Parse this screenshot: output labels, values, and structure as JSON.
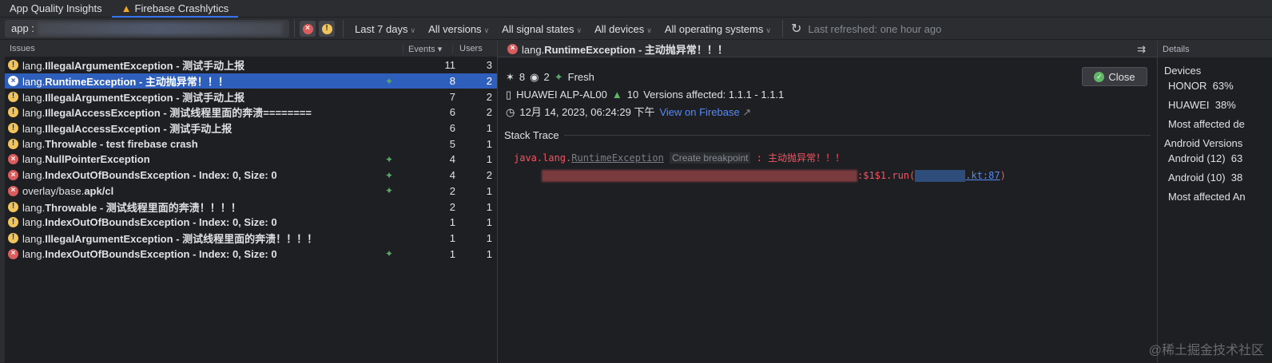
{
  "tabs": [
    {
      "label": "App Quality Insights"
    },
    {
      "label": "Firebase Crashlytics",
      "icon": "firebase-flame-icon"
    }
  ],
  "toolbar": {
    "app_prefix": "app :",
    "filters": [
      "Last 7 days",
      "All versions",
      "All signal states",
      "All devices",
      "All operating systems"
    ],
    "last_refreshed": "Last refreshed: one hour ago"
  },
  "issues": {
    "headers": {
      "issues": "Issues",
      "events": "Events",
      "users": "Users"
    },
    "rows": [
      {
        "type": "warn",
        "pre": "lang.",
        "name": "IllegalArgumentException",
        "msg": " - 测试手动上报",
        "fresh": false,
        "events": "11",
        "users": "3"
      },
      {
        "type": "error",
        "pre": "lang.",
        "name": "RuntimeException",
        "msg": " - 主动抛异常！！！",
        "fresh": true,
        "events": "8",
        "users": "2",
        "selected": true
      },
      {
        "type": "warn",
        "pre": "lang.",
        "name": "IllegalArgumentException",
        "msg": " - 测试手动上报",
        "fresh": false,
        "events": "7",
        "users": "2"
      },
      {
        "type": "warn",
        "pre": "lang.",
        "name": "IllegalAccessException",
        "msg": " - 测试线程里面的奔溃========",
        "fresh": false,
        "events": "6",
        "users": "2"
      },
      {
        "type": "warn",
        "pre": "lang.",
        "name": "IllegalAccessException",
        "msg": " - 测试手动上报",
        "fresh": false,
        "events": "6",
        "users": "1"
      },
      {
        "type": "warn",
        "pre": "lang.",
        "name": "Throwable",
        "msg": " - test firebase crash",
        "fresh": false,
        "events": "5",
        "users": "1"
      },
      {
        "type": "error",
        "pre": "lang.",
        "name": "NullPointerException",
        "msg": "",
        "fresh": true,
        "events": "4",
        "users": "1"
      },
      {
        "type": "error",
        "pre": "lang.",
        "name": "IndexOutOfBoundsException",
        "msg": " - Index: 0, Size: 0",
        "fresh": true,
        "events": "4",
        "users": "2"
      },
      {
        "type": "error",
        "pre": "overlay/base.",
        "name": "apk/cl",
        "msg": "",
        "fresh": true,
        "events": "2",
        "users": "1"
      },
      {
        "type": "warn",
        "pre": "lang.",
        "name": "Throwable",
        "msg": " - 测试线程里面的奔溃！！！！",
        "fresh": false,
        "events": "2",
        "users": "1"
      },
      {
        "type": "warn",
        "pre": "lang.",
        "name": "IndexOutOfBoundsException",
        "msg": " - Index: 0, Size: 0",
        "fresh": false,
        "events": "1",
        "users": "1"
      },
      {
        "type": "warn",
        "pre": "lang.",
        "name": "IllegalArgumentException",
        "msg": " - 测试线程里面的奔溃！！！！",
        "fresh": false,
        "events": "1",
        "users": "1"
      },
      {
        "type": "error",
        "pre": "lang.",
        "name": "IndexOutOfBoundsException",
        "msg": " - Index: 0, Size: 0",
        "fresh": true,
        "events": "1",
        "users": "1"
      }
    ]
  },
  "detail": {
    "title_pre": "lang.",
    "title_name": "RuntimeException",
    "title_msg": " - 主动抛异常！！！",
    "events": "8",
    "users": "2",
    "fresh": "Fresh",
    "device": "HUAWEI ALP-AL00",
    "android": "10",
    "versions": "Versions affected: 1.1.1 - 1.1.1",
    "timestamp": "12月 14, 2023, 06:24:29 下午",
    "view_link": "View on Firebase",
    "close": "Close",
    "stack_title": "Stack Trace",
    "stack": {
      "pkg": "java.lang.",
      "cls": "RuntimeException",
      "bp": "Create breakpoint",
      "msg": " : 主动抛异常！！！",
      "frame": ":$1$1.run(",
      "file": ".kt:87",
      ")": ")"
    }
  },
  "details_panel": {
    "title": "Details",
    "devices_title": "Devices",
    "devices": [
      {
        "name": "HONOR",
        "pct": "63%"
      },
      {
        "name": "HUAWEI",
        "pct": "38%"
      }
    ],
    "most_device": "Most affected de",
    "android_title": "Android Versions",
    "android": [
      {
        "name": "Android (12)",
        "pct": "63"
      },
      {
        "name": "Android (10)",
        "pct": "38"
      }
    ],
    "most_android": "Most affected An"
  },
  "watermark": "@稀土掘金技术社区"
}
